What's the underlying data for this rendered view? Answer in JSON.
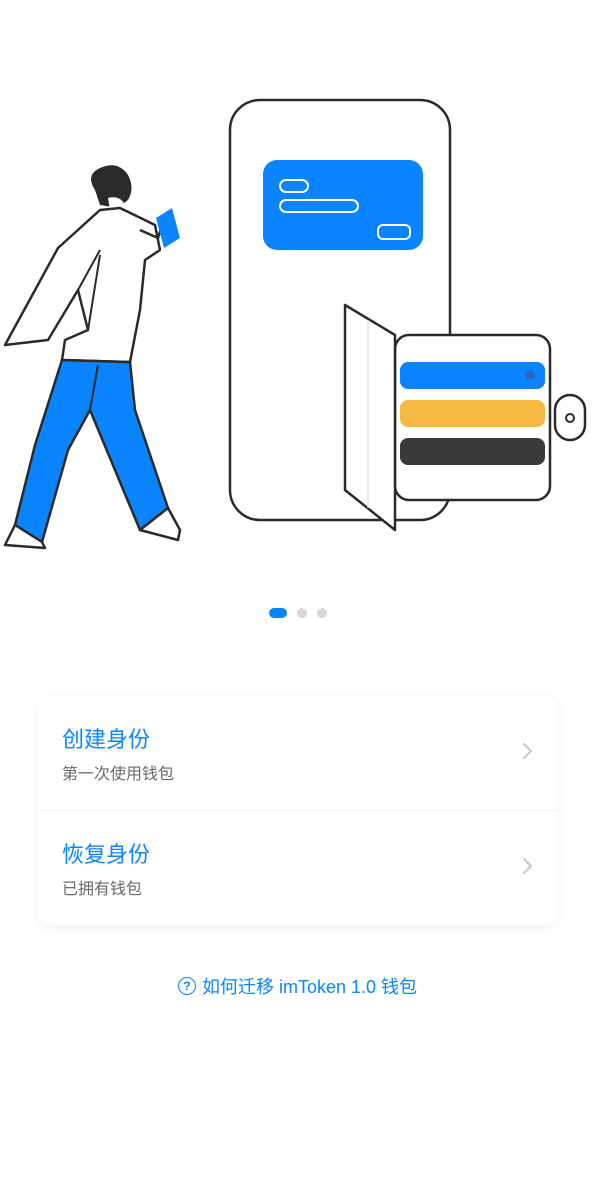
{
  "carousel": {
    "current_index": 0,
    "total": 3
  },
  "options": [
    {
      "title": "创建身份",
      "subtitle": "第一次使用钱包"
    },
    {
      "title": "恢复身份",
      "subtitle": "已拥有钱包"
    }
  ],
  "help_link": {
    "text": "如何迁移 imToken 1.0 钱包"
  },
  "colors": {
    "primary": "#0a84ff",
    "text_secondary": "#6a6a6a",
    "dot_inactive": "#d8d8d8"
  }
}
